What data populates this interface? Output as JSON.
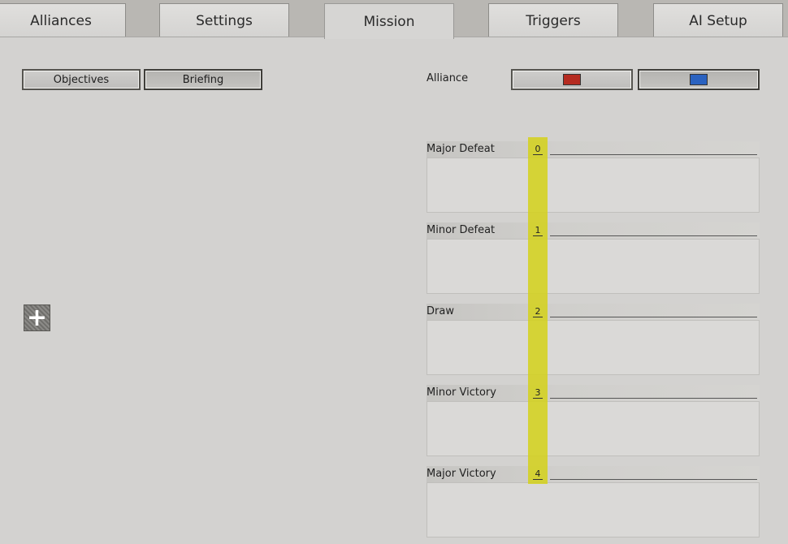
{
  "tabs": [
    {
      "label": "Alliances"
    },
    {
      "label": "Settings"
    },
    {
      "label": "Mission"
    },
    {
      "label": "Triggers"
    },
    {
      "label": "AI Setup"
    }
  ],
  "subtabs": {
    "objectives": "Objectives",
    "briefing": "Briefing"
  },
  "alliance": {
    "label": "Alliance",
    "colors": {
      "red": "#b52b20",
      "blue": "#2a62c0"
    }
  },
  "outcomes": [
    {
      "name": "Major Defeat",
      "index": "0"
    },
    {
      "name": "Minor Defeat",
      "index": "1"
    },
    {
      "name": "Draw",
      "index": "2"
    },
    {
      "name": "Minor Victory",
      "index": "3"
    },
    {
      "name": "Major Victory",
      "index": "4"
    }
  ],
  "highlight_color": "#d4d11a"
}
